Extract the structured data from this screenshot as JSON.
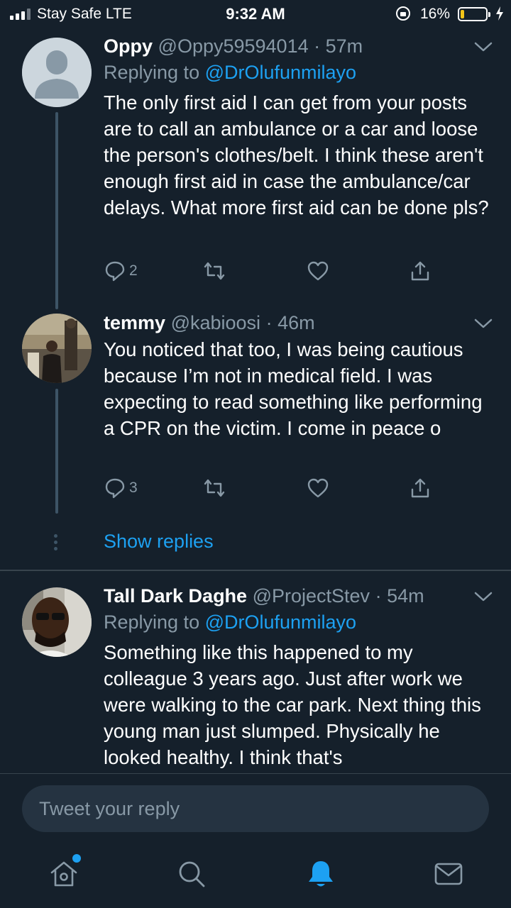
{
  "status_bar": {
    "carrier": "Stay Safe  LTE",
    "time": "9:32 AM",
    "battery_percent": "16%",
    "battery_level": 0.16,
    "battery_color": "#f5c518"
  },
  "tweets": [
    {
      "name": "Oppy",
      "handle": "@Oppy59594014",
      "dot": "·",
      "time": "57m",
      "replying_prefix": "Replying to",
      "replying_to": "@DrOlufunmilayo",
      "text": "The only first aid I can get from your posts are to call an ambulance or a car and loose the person's clothes/belt. I think these aren't enough first aid in case the ambulance/car delays. What more first aid can be done pls?",
      "reply_count": "2",
      "avatar_icon": "default-avatar-icon"
    },
    {
      "name": "temmy",
      "handle": "@kabioosi",
      "dot": "·",
      "time": "46m",
      "text": "You noticed that too, I was being cautious because I’m not in medical field. I was expecting to read something like performing a CPR on the victim. I come in peace o",
      "reply_count": "3",
      "avatar_icon": "user-photo-avatar"
    },
    {
      "name": "Tall Dark Daghe",
      "handle": "@ProjectStev",
      "dot": "·",
      "time": "54m",
      "replying_prefix": "Replying to",
      "replying_to": "@DrOlufunmilayo",
      "text": "Something like this happened to my colleague 3 years ago. Just after work we were walking to the car park. Next thing this young man just slumped. Physically he looked healthy. I think that's",
      "avatar_icon": "user-photo-avatar"
    }
  ],
  "show_replies": "Show replies",
  "composer": {
    "placeholder": "Tweet your reply"
  },
  "nav": {
    "items": [
      "home-icon",
      "search-icon",
      "notifications-icon",
      "messages-icon"
    ],
    "active": "notifications-icon"
  },
  "colors": {
    "background": "#15202b",
    "accent": "#1da1f2",
    "secondary_text": "#8899a6"
  }
}
